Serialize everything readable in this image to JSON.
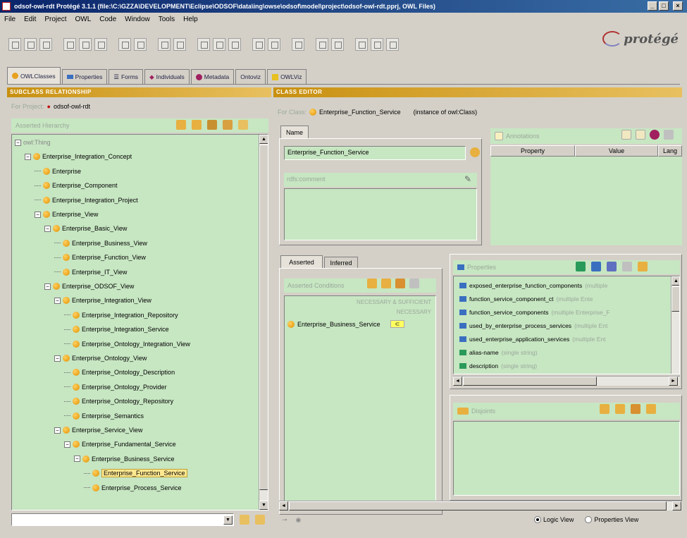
{
  "window": {
    "title": "odsof-owl-rdt  Protégé 3.1.1    (file:\\C:\\GZZA\\DEVELOPMENT\\Eclipse\\ODSOF\\data\\ing\\owse\\odsof\\model\\project\\odsof-owl-rdt.pprj, OWL Files)"
  },
  "menu": [
    "File",
    "Edit",
    "Project",
    "OWL",
    "Code",
    "Window",
    "Tools",
    "Help"
  ],
  "logo": "protégé",
  "tabs": [
    {
      "label": "OWLClasses",
      "color": "#e8a020"
    },
    {
      "label": "Properties",
      "color": "#3a6fc0"
    },
    {
      "label": "Forms",
      "color": "#888888"
    },
    {
      "label": "Individuals",
      "color": "#a02060"
    },
    {
      "label": "Metadata",
      "color": "#a02060"
    },
    {
      "label": "Ontoviz",
      "color": "#888888"
    },
    {
      "label": "OWLViz",
      "color": "#e8c020"
    }
  ],
  "left_panel": {
    "header": "SUBCLASS RELATIONSHIP",
    "for_project_label": "For Project:",
    "project_name": "odsof-owl-rdt",
    "hierarchy_label": "Asserted Hierarchy",
    "tree": [
      {
        "label": "owl:Thing",
        "depth": 0
      },
      {
        "label": "Enterprise_Integration_Concept",
        "depth": 1
      },
      {
        "label": "Enterprise",
        "depth": 2
      },
      {
        "label": "Enterprise_Component",
        "depth": 2
      },
      {
        "label": "Enterprise_Integration_Project",
        "depth": 2
      },
      {
        "label": "Enterprise_View",
        "depth": 2
      },
      {
        "label": "Enterprise_Basic_View",
        "depth": 3
      },
      {
        "label": "Enterprise_Business_View",
        "depth": 4
      },
      {
        "label": "Enterprise_Function_View",
        "depth": 4
      },
      {
        "label": "Enterprise_IT_View",
        "depth": 4
      },
      {
        "label": "Enterprise_ODSOF_View",
        "depth": 3
      },
      {
        "label": "Enterprise_Integration_View",
        "depth": 4
      },
      {
        "label": "Enterprise_Integration_Repository",
        "depth": 5
      },
      {
        "label": "Enterprise_Integration_Service",
        "depth": 5
      },
      {
        "label": "Enterprise_Ontology_Integration_View",
        "depth": 5
      },
      {
        "label": "Enterprise_Ontology_View",
        "depth": 4
      },
      {
        "label": "Enterprise_Ontology_Description",
        "depth": 5
      },
      {
        "label": "Enterprise_Ontology_Provider",
        "depth": 5
      },
      {
        "label": "Enterprise_Ontology_Repository",
        "depth": 5
      },
      {
        "label": "Enterprise_Semantics",
        "depth": 5
      },
      {
        "label": "Enterprise_Service_View",
        "depth": 4
      },
      {
        "label": "Enterprise_Fundamental_Service",
        "depth": 5
      },
      {
        "label": "Enterprise_Business_Service",
        "depth": 6
      },
      {
        "label": "Enterprise_Function_Service",
        "depth": 7
      },
      {
        "label": "Enterprise_Process_Service",
        "depth": 7
      }
    ],
    "selected": "Enterprise_Function_Service"
  },
  "right_panel": {
    "header": "CLASS EDITOR",
    "for_class_label": "For Class:",
    "class_name": "Enterprise_Function_Service",
    "instance_of": "(instance of owl:Class)",
    "name_tab": "Name",
    "name_value": "Enterprise_Function_Service",
    "rdfs_comment": "rdfs:comment",
    "annotations_label": "Annotations",
    "annotation_columns": [
      "Property",
      "Value",
      "Lang"
    ],
    "asserted_tab": "Asserted",
    "inferred_tab": "Inferred",
    "asserted_conditions_label": "Asserted Conditions",
    "necessary_sufficient": "NECESSARY & SUFFICIENT",
    "necessary": "NECESSARY",
    "condition_item": "Enterprise_Business_Service",
    "condition_tag": "⊂",
    "properties_label": "Properties",
    "properties": [
      {
        "name": "exposed_enterprise_function_components",
        "range": "(multiple",
        "type": "object"
      },
      {
        "name": "function_service_component_ct",
        "range": "(multiple Ente",
        "type": "object"
      },
      {
        "name": "function_service_components",
        "range": "(multiple Enterprise_F",
        "type": "object"
      },
      {
        "name": "used_by_enterprise_process_services",
        "range": "(multiple Ent",
        "type": "object"
      },
      {
        "name": "used_enterprise_application_services",
        "range": "(multiple Ent",
        "type": "object"
      },
      {
        "name": "alias-name",
        "range": "(single string)",
        "type": "datatype"
      },
      {
        "name": "description",
        "range": "(single string)",
        "type": "datatype"
      }
    ],
    "disjoints_label": "Disjoints",
    "logic_view": "Logic View",
    "properties_view": "Properties View"
  }
}
